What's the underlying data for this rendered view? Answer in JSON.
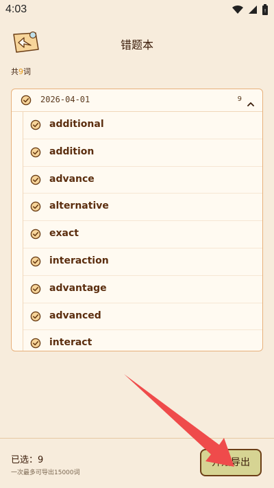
{
  "status_bar": {
    "time": "4:03",
    "icons": [
      "wifi-icon",
      "signal-icon",
      "battery-icon"
    ]
  },
  "header": {
    "title": "错题本",
    "back_icon": "back-arrow-icon"
  },
  "count": {
    "prefix": "共",
    "number": "9",
    "suffix": "词"
  },
  "group": {
    "date": "2026-04-01",
    "count": "9",
    "expanded": true
  },
  "words": [
    "additional",
    "addition",
    "advance",
    "alternative",
    "exact",
    "interaction",
    "advantage",
    "advanced",
    "interact"
  ],
  "footer": {
    "selected_label": "已选：",
    "selected_count": "9",
    "note": "一次最多可导出15000词",
    "export_label": "开始导出"
  },
  "colors": {
    "background": "#f7ecdc",
    "accent": "#e69a1a",
    "text": "#5b2e0f",
    "button": "#d6d493",
    "arrow": "#ef4b4b"
  }
}
